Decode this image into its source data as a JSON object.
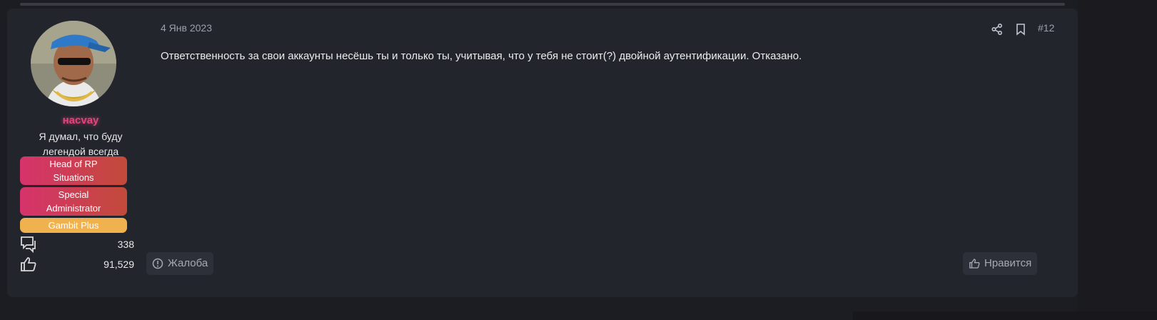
{
  "post": {
    "date": "4 Янв 2023",
    "number": "#12",
    "body": "Ответственность за свои аккаунты несёшь ты и только ты, учитывая, что у тебя не стоит(?) двойной аутентификации. Отказано.",
    "report_label": "Жалоба",
    "like_label": "Нравится"
  },
  "user": {
    "name": "насvay",
    "title_line1": "Я думал, что буду",
    "title_line2": "легендой всегда",
    "badges": [
      {
        "line1": "Head of RP",
        "line2": "Situations"
      },
      {
        "line1": "Special",
        "line2": "Administrator"
      },
      {
        "line1": "Gambit Plus",
        "line2": ""
      }
    ],
    "messages_count": "338",
    "reactions_count": "91,529"
  },
  "icons": {
    "share": "share-icon",
    "bookmark": "bookmark-icon",
    "messages": "chat-bubbles-icon",
    "reactions": "thumbs-up-icon",
    "report": "alert-circle-icon",
    "like": "thumbs-up-icon"
  },
  "colors": {
    "username": "#e0457a",
    "badge_red": "#d6336c",
    "badge_gold": "#f0b24f",
    "post_bg": "#23252d"
  }
}
